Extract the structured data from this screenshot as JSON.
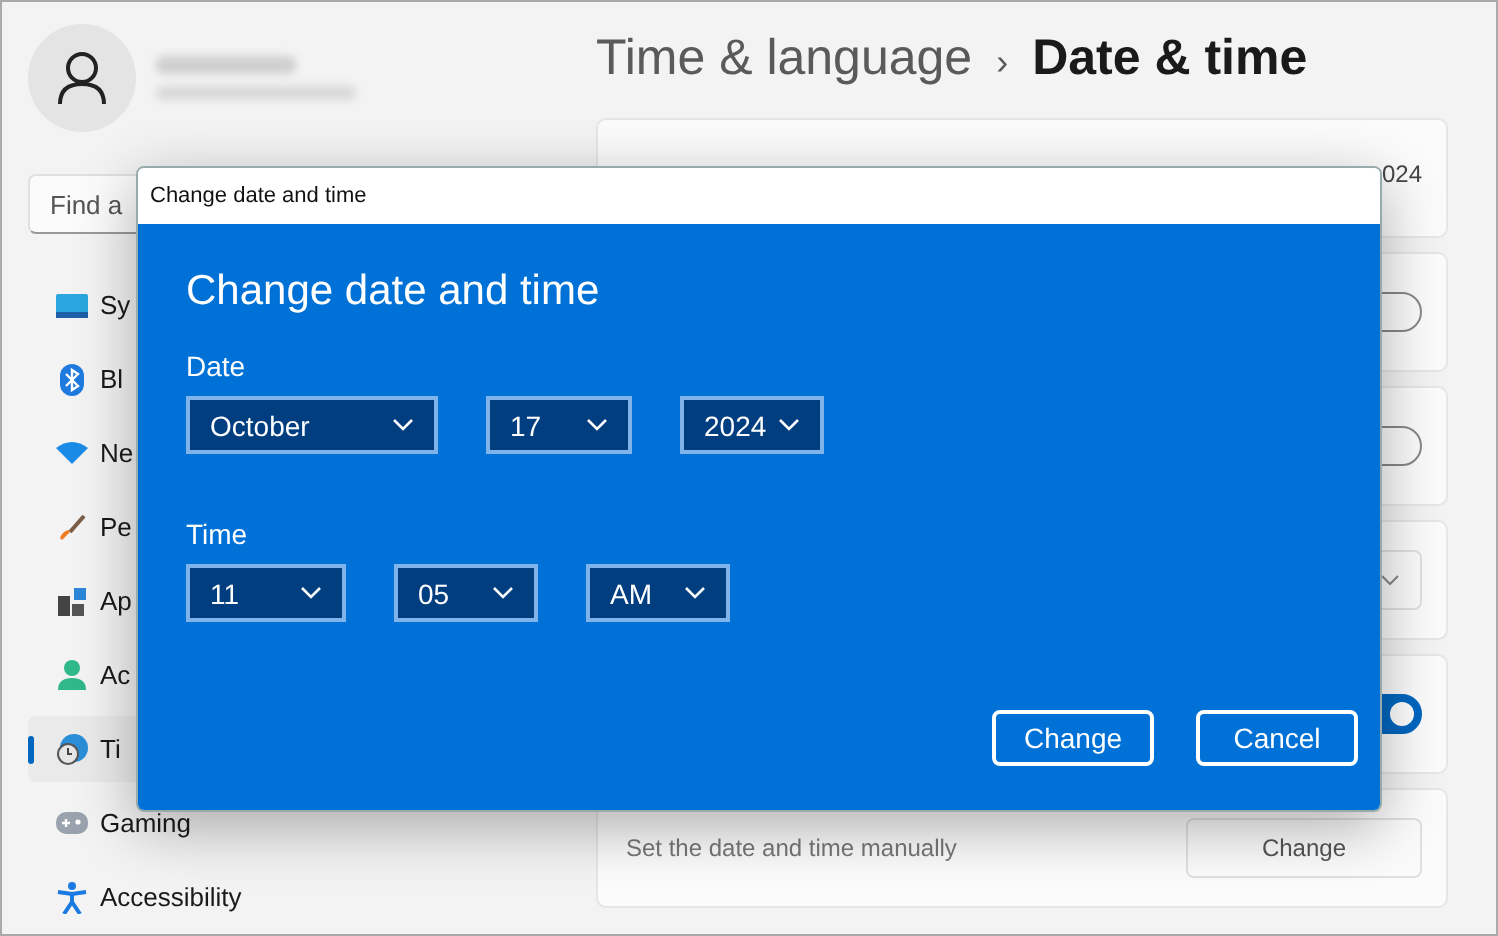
{
  "breadcrumb": {
    "parent": "Time & language",
    "separator": "›",
    "current": "Date & time"
  },
  "search": {
    "placeholder": "Find a"
  },
  "sidebar": {
    "items": [
      {
        "label": "Sy",
        "selected": false
      },
      {
        "label": "Bl",
        "selected": false
      },
      {
        "label": "Ne",
        "selected": false
      },
      {
        "label": "Pe",
        "selected": false
      },
      {
        "label": "Ap",
        "selected": false
      },
      {
        "label": "Ac",
        "selected": false
      },
      {
        "label": "Ti",
        "selected": true
      },
      {
        "label": "Gaming",
        "selected": false
      },
      {
        "label": "Accessibility",
        "selected": false
      }
    ]
  },
  "cards": [
    {
      "kind": "value",
      "value": "024"
    },
    {
      "kind": "toggle",
      "on": false
    },
    {
      "kind": "toggle",
      "on": false
    },
    {
      "kind": "dropdown"
    },
    {
      "kind": "toggle",
      "on": true
    },
    {
      "kind": "action",
      "label": "Set the date and time manually",
      "button": "Change"
    }
  ],
  "dialog": {
    "title": "Change date and time",
    "heading": "Change date and time",
    "date_label": "Date",
    "date": [
      "October",
      "17",
      "2024"
    ],
    "time_label": "Time",
    "time": [
      "11",
      "05",
      "AM"
    ],
    "buttons": [
      "Change",
      "Cancel"
    ]
  }
}
